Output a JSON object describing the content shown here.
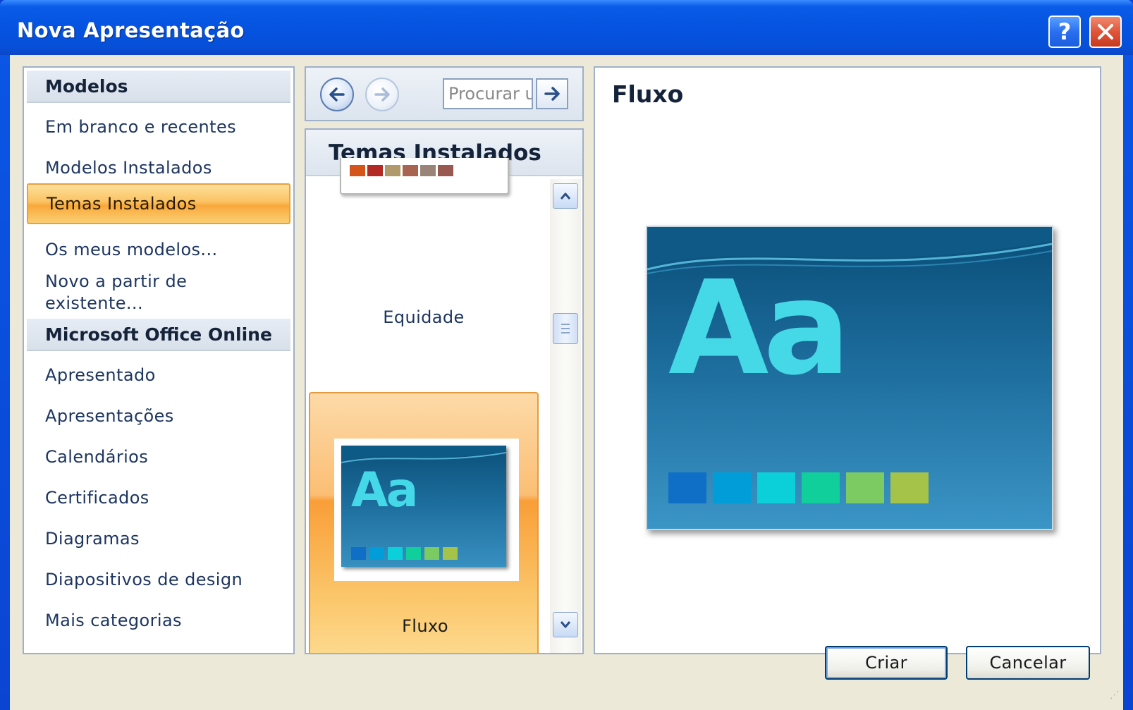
{
  "window": {
    "title": "Nova Apresentação"
  },
  "titlebar": {
    "help_label": "?",
    "close_label": "✕"
  },
  "sidebar": {
    "sections": [
      {
        "header": "Modelos",
        "items": [
          "Em branco e recentes",
          "Modelos Instalados",
          "Temas Instalados",
          "Os meus modelos...",
          "Novo a partir de existente..."
        ]
      },
      {
        "header": "Microsoft Office Online",
        "items": [
          "Apresentado",
          "Apresentações",
          "Calendários",
          "Certificados",
          "Diagramas",
          "Diapositivos de design",
          "Mais categorias"
        ]
      }
    ],
    "selected_item": "Temas Instalados"
  },
  "navigation": {
    "back_icon": "arrow-left-icon",
    "forward_icon": "arrow-right-icon",
    "search_placeholder": "Procurar u",
    "search_go_icon": "arrow-right-icon"
  },
  "themes_list": {
    "title": "Temas Instalados",
    "items": [
      {
        "name": "Equidade",
        "swatches": [
          "#d4541a",
          "#b32a24",
          "#b09a6c",
          "#a86450",
          "#9a8478",
          "#985a50"
        ]
      },
      {
        "name": "Fluxo",
        "selected": true,
        "swatches": [
          "#0f6fc6",
          "#009dd9",
          "#0bd0d9",
          "#10cf9b",
          "#7cca62",
          "#a5c249"
        ]
      }
    ]
  },
  "preview": {
    "title": "Fluxo",
    "sample_text": "Aa",
    "swatches": [
      "#0f6fc6",
      "#009dd9",
      "#0bd0d9",
      "#10cf9b",
      "#7cca62",
      "#a5c249"
    ]
  },
  "buttons": {
    "create": "Criar",
    "cancel": "Cancelar"
  }
}
